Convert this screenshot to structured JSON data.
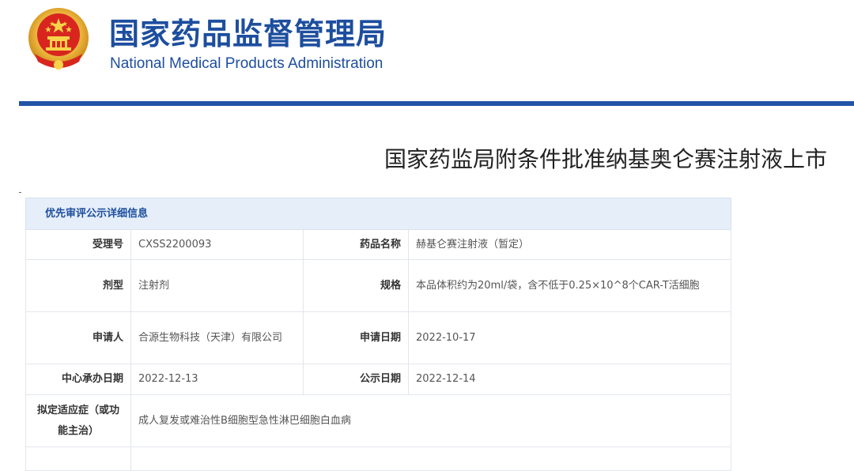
{
  "header": {
    "brand_cn": "国家药品监督管理局",
    "brand_en": "National Medical Products Administration",
    "emblem_icon": "national-emblem-icon",
    "brand_color": "#1d4e9e"
  },
  "article": {
    "title": "国家药监局附条件批准纳基奥仑赛注射液上市"
  },
  "table": {
    "section_title": "优先审评公示详细信息",
    "rows": [
      {
        "label_a": "受理号",
        "value_a": "CXSS2200093",
        "label_b": "药品名称",
        "value_b": "赫基仑赛注射液（暂定）"
      },
      {
        "label_a": "剂型",
        "value_a": "注射剂",
        "label_b": "规格",
        "value_b": "本品体积约为20ml/袋，含不低于0.25×10^8个CAR-T活细胞"
      },
      {
        "label_a": "申请人",
        "value_a": "合源生物科技（天津）有限公司",
        "label_b": "申请日期",
        "value_b": "2022-10-17"
      },
      {
        "label_a": "中心承办日期",
        "value_a": "2022-12-13",
        "label_b": "公示日期",
        "value_b": "2022-12-14"
      }
    ],
    "indication": {
      "label": "拟定适应症（或功能主治）",
      "value": "成人复发或难治性B细胞型急性淋巴细胞白血病"
    }
  }
}
